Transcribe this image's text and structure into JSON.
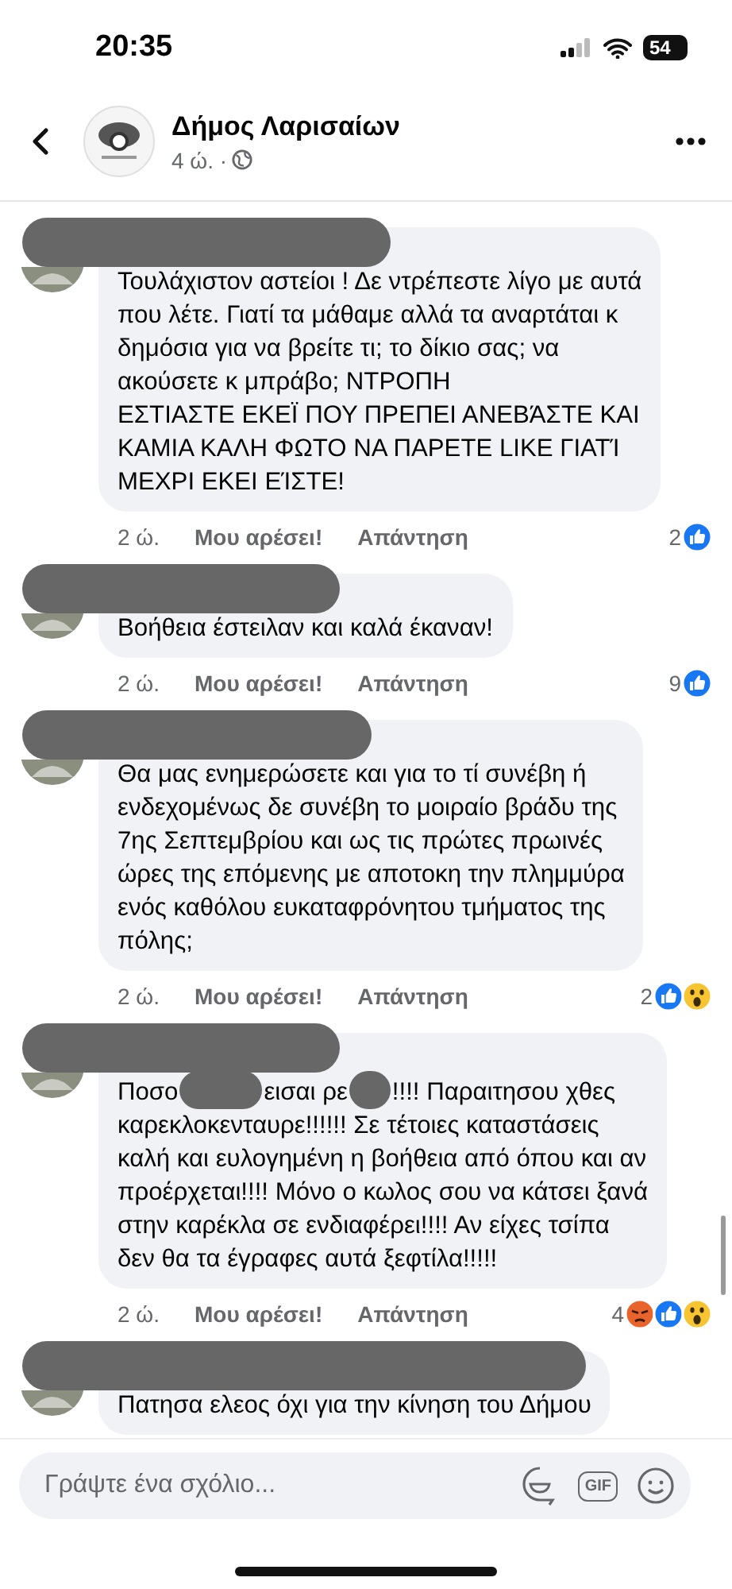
{
  "status_bar": {
    "time": "20:35",
    "battery": "54"
  },
  "header": {
    "page_name": "Δήμος Λαρισαίων",
    "meta": "4 ώ. ·"
  },
  "comments": [
    {
      "author_hidden": true,
      "segments": [
        "Τουλάχιστον αστείοι ! Δε ντρέπεστε λίγο με αυτά\nπου λέτε. Γιατί τα μάθαμε αλλά τα αναρτάται κ\nδημόσια για να βρείτε τι; το δίκιο σας; να\nακούσετε κ μπράβο; ΝΤΡΟΠΗ\nΕΣΤΙΑΣΤΕ ΕΚΕΪ ΠΟΥ ΠΡΕΠΕΙ ΑΝΕΒΆΣΤΕ ΚΑΙ\nΚΑΜΙΑ ΚΑΛΗ ΦΩΤΟ ΝΑ ΠΑΡΕΤΕ LIKE ΓΙΑΤΊ\nΜΕΧΡΙ ΕΚΕΙ ΕΊΣΤΕ!"
      ],
      "time": "2 ώ.",
      "like": "Μου αρέσει!",
      "reply": "Απάντηση",
      "reaction_count": "2",
      "reactions": [
        {
          "kind": "like"
        }
      ]
    },
    {
      "author_hidden": true,
      "segments": [
        "Βοήθεια έστειλαν και καλά έκαναν!"
      ],
      "time": "2 ώ.",
      "like": "Μου αρέσει!",
      "reply": "Απάντηση",
      "reaction_count": "9",
      "reactions": [
        {
          "kind": "like"
        }
      ]
    },
    {
      "author_hidden": true,
      "segments": [
        "Θα μας ενημερώσετε και για το τί συνέβη ή\nενδεχομένως δε συνέβη το μοιραίο βράδυ της\n7ης Σεπτεμβρίου και ως τις πρώτες πρωινές\nώρες της επόμενης με αποτοκη την πλημμύρα\nενός καθόλου ευκαταφρόνητου τμήματος της\nπόλης;"
      ],
      "time": "2 ώ.",
      "like": "Μου αρέσει!",
      "reply": "Απάντηση",
      "reaction_count": "2",
      "reactions": [
        {
          "kind": "like"
        },
        {
          "kind": "wow"
        }
      ]
    },
    {
      "author_hidden": true,
      "segments": [
        "Ποσο",
        "εισαι ρε",
        "!!!! Παραιτησου χθες\nκαρεκλοκενταυρε!!!!!! Σε τέτοιες καταστάσεις\nκαλή και ευλογημένη η βοήθεια από όπου και αν\nπροέρχεται!!!! Μόνο ο κωλος σου να κάτσει ξανά\nστην καρέκλα σε ενδιαφέρει!!!! Αν είχες τσίπα\nδεν θα τα έγραφες αυτά ξεφτίλα!!!!!"
      ],
      "time": "2 ώ.",
      "like": "Μου αρέσει!",
      "reply": "Απάντηση",
      "reaction_count": "4",
      "reactions": [
        {
          "kind": "angry"
        },
        {
          "kind": "like"
        },
        {
          "kind": "wow"
        }
      ]
    },
    {
      "author_hidden": true,
      "segments": [
        "Πατησα ελεος όχι για την κίνηση του Δήμου"
      ]
    }
  ],
  "composer": {
    "placeholder": "Γράψτε ένα σχόλιο...",
    "gif_label": "GIF"
  }
}
